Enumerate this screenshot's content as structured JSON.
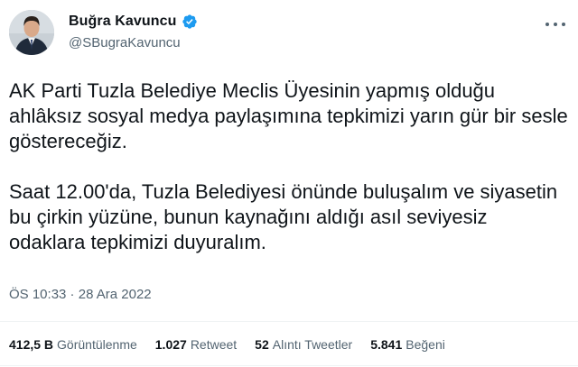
{
  "author": {
    "name": "Buğra Kavuncu",
    "handle": "@SBugraKavuncu",
    "verified_color": "#1d9bf0"
  },
  "tweet": {
    "paragraph1": "AK Parti Tuzla Belediye Meclis Üyesinin yapmış olduğu ahlâksız sosyal medya paylaşımına tepkimizi yarın gür bir sesle göstereceğiz.",
    "paragraph2": "Saat 12.00'da, Tuzla Belediyesi önünde buluşalım ve siyasetin bu çirkin yüzüne, bunun kaynağını aldığı asıl seviyesiz odaklara tepkimizi duyuralım."
  },
  "meta": {
    "time": "ÖS 10:33",
    "separator": " · ",
    "date": "28 Ara 2022"
  },
  "stats": [
    {
      "value": "412,5 B",
      "label": "Görüntülenme"
    },
    {
      "value": "1.027",
      "label": "Retweet"
    },
    {
      "value": "52",
      "label": "Alıntı Tweetler"
    },
    {
      "value": "5.841",
      "label": "Beğeni"
    }
  ],
  "icons": {
    "verified": "verified-badge-icon",
    "more": "more-options-icon"
  }
}
